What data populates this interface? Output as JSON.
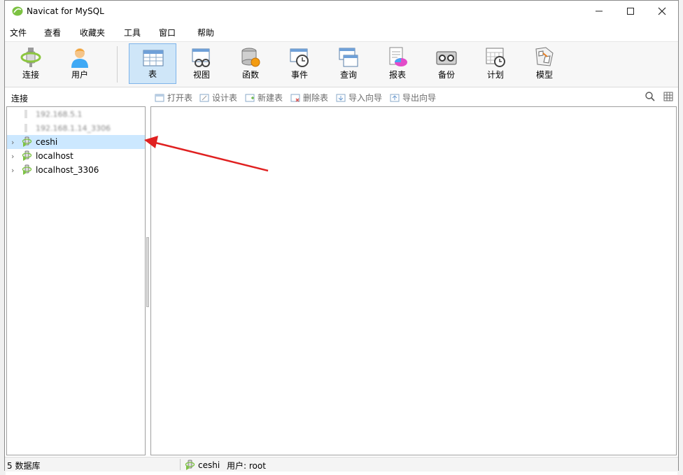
{
  "window": {
    "title": "Navicat for MySQL"
  },
  "menu": [
    "文件",
    "查看",
    "收藏夹",
    "工具",
    "窗口",
    "帮助"
  ],
  "toolbar": [
    {
      "id": "connect",
      "label": "连接",
      "icon": "plug-icon"
    },
    {
      "id": "user",
      "label": "用户",
      "icon": "user-icon"
    },
    {
      "id": "table",
      "label": "表",
      "icon": "table-icon",
      "active": true
    },
    {
      "id": "view",
      "label": "视图",
      "icon": "view-icon"
    },
    {
      "id": "function",
      "label": "函数",
      "icon": "function-icon"
    },
    {
      "id": "event",
      "label": "事件",
      "icon": "event-icon"
    },
    {
      "id": "query",
      "label": "查询",
      "icon": "query-icon"
    },
    {
      "id": "report",
      "label": "报表",
      "icon": "report-icon"
    },
    {
      "id": "backup",
      "label": "备份",
      "icon": "backup-icon"
    },
    {
      "id": "schedule",
      "label": "计划",
      "icon": "schedule-icon"
    },
    {
      "id": "model",
      "label": "模型",
      "icon": "model-icon"
    }
  ],
  "subtoolbar": {
    "connection_label": "连接",
    "buttons": [
      "打开表",
      "设计表",
      "新建表",
      "删除表",
      "导入向导",
      "导出向导"
    ]
  },
  "tree": [
    {
      "label": "192.168.5.1",
      "blurred": true
    },
    {
      "label": "192.168.1.14_3306",
      "blurred": true
    },
    {
      "label": "ceshi",
      "selected": true
    },
    {
      "label": "localhost"
    },
    {
      "label": "localhost_3306"
    }
  ],
  "status": {
    "db_count": "5 数据库",
    "connection": "ceshi",
    "user": "用户: root"
  },
  "colors": {
    "accent": "#cfe6f8",
    "selected_row": "#cce8ff",
    "annotation_arrow": "#e02020"
  }
}
